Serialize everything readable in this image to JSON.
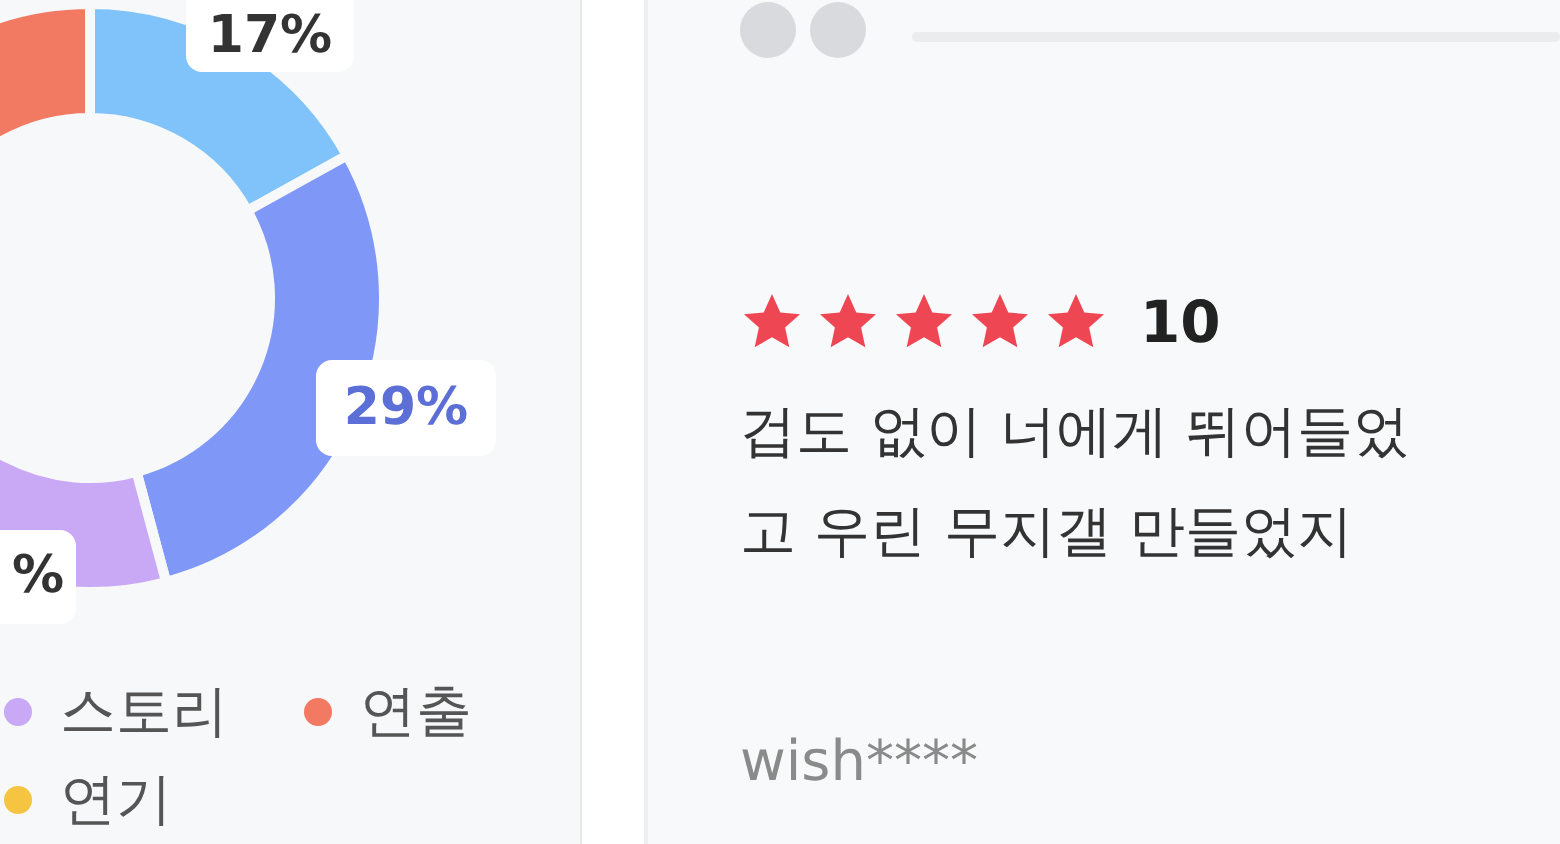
{
  "chart": {
    "labels": [
      {
        "text": "17%",
        "color": "#333333"
      },
      {
        "text": "29%",
        "color": "#5b6fd6"
      },
      {
        "text": "%",
        "color": "#333333"
      }
    ]
  },
  "legend": [
    {
      "label": "스토리",
      "color": "#c9a8f5"
    },
    {
      "label": "연출",
      "color": "#f37a62"
    },
    {
      "label": "연기",
      "color": "#f5c542"
    }
  ],
  "review": {
    "stars": 5,
    "score": "10",
    "text_lines": [
      "겁도 없이 너에게 뛰어들었",
      "고 우린 무지갤 만들었지"
    ],
    "author": "wish****"
  }
}
